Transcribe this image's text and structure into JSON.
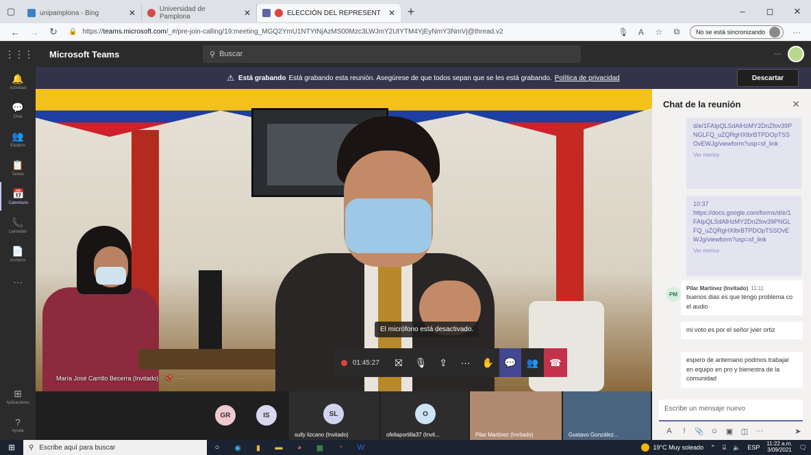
{
  "browser": {
    "tabs": [
      {
        "label": "unipamplona - Bing",
        "favicon_color": "#3b82c4"
      },
      {
        "label": "Universidad de Pamplona",
        "favicon_color": "#d44b4b"
      },
      {
        "label": "ELECCIÓN DEL REPRESENT",
        "favicon_color": "#6264a7"
      }
    ],
    "new_tab": "+",
    "url_prefix": "https://",
    "url_host": "teams.microsoft.com",
    "url_rest": "/_#/pre-join-calling/19:meeting_MGQ2YmU1NTYtNjAzMS00Mzc3LWJmY2UtYTM4YjEyNmY3NmVj@thread.v2",
    "sync_label": "No se está sincronizando",
    "min": "–",
    "max": "◻",
    "close": "✕"
  },
  "teams": {
    "app_name": "Microsoft Teams",
    "search_placeholder": "Buscar",
    "more": "···",
    "rail": [
      {
        "label": "Actividad",
        "glyph": "🔔"
      },
      {
        "label": "Chat",
        "glyph": "💬"
      },
      {
        "label": "Equipos",
        "glyph": "👥"
      },
      {
        "label": "Tareas",
        "glyph": "📋"
      },
      {
        "label": "Calendario",
        "glyph": "📅"
      },
      {
        "label": "Llamadas",
        "glyph": "📞"
      },
      {
        "label": "Archivos",
        "glyph": "📄"
      },
      {
        "label": "",
        "glyph": "···"
      }
    ],
    "rail_bottom": [
      {
        "label": "Aplicaciones",
        "glyph": "⊞"
      },
      {
        "label": "Ayuda",
        "glyph": "?"
      }
    ]
  },
  "recording_banner": {
    "warning": "⚠",
    "bold": "Está grabando",
    "text": "Está grabando esta reunión. Asegúrese de que todos sepan que se les está grabando.",
    "link": "Política de privacidad",
    "discard": "Descartar"
  },
  "stage": {
    "speaker_name": "María José Carrillo Becerra (Invitado)",
    "mic_toast": "El micrófono está desactivado.",
    "timer": "01:45:27"
  },
  "gallery": [
    {
      "initials": "GR",
      "color": "#f0c8d0",
      "name": ""
    },
    {
      "initials": "IS",
      "color": "#d8d8f0",
      "name": ""
    },
    {
      "initials": "SL",
      "color": "#d0d4f0",
      "name": "sully lizcano (Invitado)"
    },
    {
      "initials": "O",
      "color": "#cde4f5",
      "name": "ofeliaportilla37 (Invit..."
    },
    {
      "initials": "",
      "color": "#b08a70",
      "name": "Pilar Martinez (Invitado)"
    },
    {
      "initials": "",
      "color": "#4a6480",
      "name": "Gustavo González..."
    }
  ],
  "chat": {
    "title": "Chat de la reunión",
    "close": "✕",
    "messages": [
      {
        "text": "d/e/1FAIpQLSdAlHzMY2DnZfov39PNGLFQ_uZQRgHXlbrBTPDOpTSSOvEWJg/viewform?usp=sf_link",
        "toggle": "Ver menos"
      },
      {
        "time": "10:37",
        "text": "https://docs.google.com/forms/d/e/1FAIpQLSdAlHzMY2DnZfov39PNGLFQ_uZQRgHXlbrBTPDOpTSSOvEWJg/viewform?usp=sf_link",
        "toggle": "Ver menos"
      }
    ],
    "reply_avatar": "PM",
    "reply_author": "Pilar Martinez (Invitado)",
    "reply_time": "11:11",
    "replies": [
      "buenos dias es que tengo problema co el audio",
      "mi voto es por el señor jvier ortiz",
      "espero de antemano podmos trabajar en equipo en pro y bienestra de la comunidad"
    ],
    "compose_placeholder": "Escribe un mensaje nuevo"
  },
  "taskbar": {
    "search_placeholder": "Escribe aquí para buscar",
    "weather": "19°C  Muy soleado",
    "lang": "ESP",
    "time": "11:22 a.m.",
    "date": "3/09/2021"
  }
}
